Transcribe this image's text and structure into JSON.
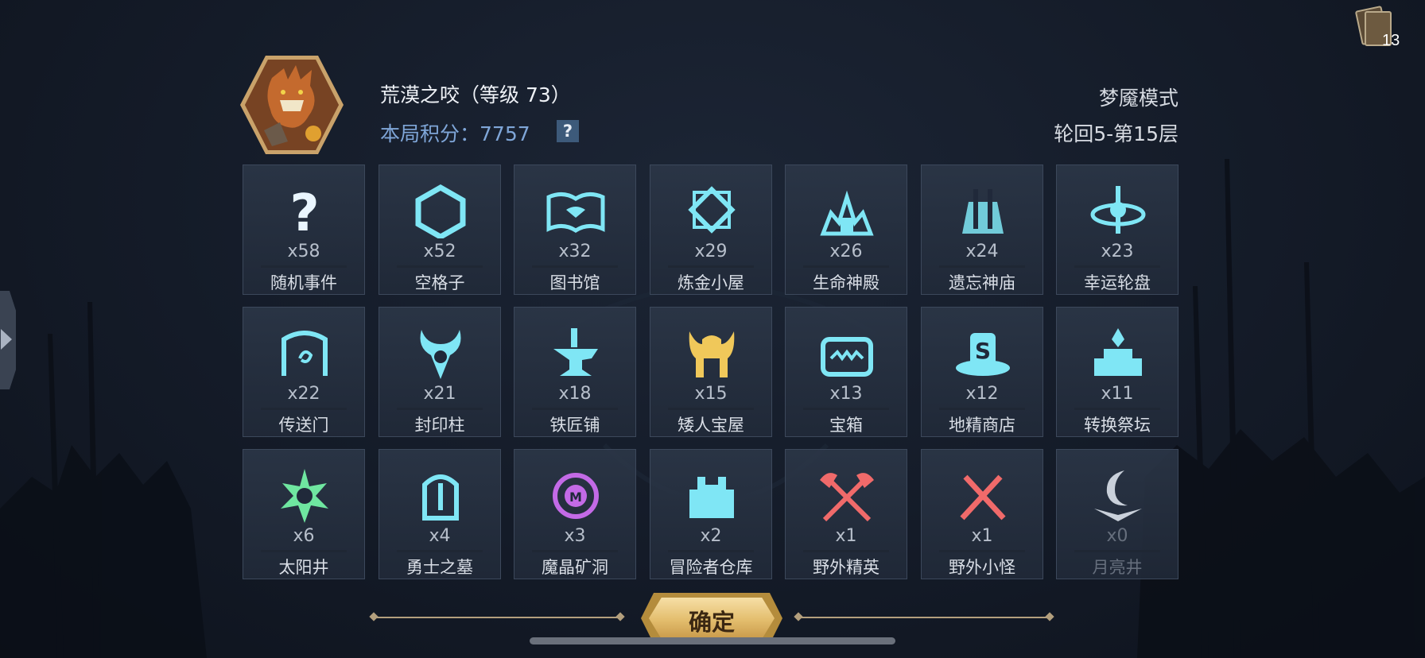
{
  "deck": {
    "icon": "card-deck-icon",
    "count": "13"
  },
  "side_tab": {
    "icon": "chevron-right-icon"
  },
  "player": {
    "avatar_icon": "werewolf-hero-portrait",
    "name_line": "荒漠之咬（等级 73）",
    "score_label": "本局积分：",
    "score_value": "7757",
    "help_label": "?"
  },
  "mode": {
    "name": "梦魇模式",
    "floor": "轮回5-第15层"
  },
  "colors": {
    "accent_cyan": "#7fe6f5",
    "gold": "#f0c85a",
    "red": "#f06a6a",
    "green": "#6fe6a0",
    "purple": "#c36ae6"
  },
  "tiles": [
    {
      "count": "x58",
      "name": "随机事件",
      "icon": "question-mark-icon",
      "color": "#eaf6ff"
    },
    {
      "count": "x52",
      "name": "空格子",
      "icon": "hexagon-icon",
      "color": "#7fe6f5"
    },
    {
      "count": "x32",
      "name": "图书馆",
      "icon": "open-book-icon",
      "color": "#7fe6f5"
    },
    {
      "count": "x29",
      "name": "炼金小屋",
      "icon": "alchemy-diamond-icon",
      "color": "#7fe6f5"
    },
    {
      "count": "x26",
      "name": "生命神殿",
      "icon": "temple-of-life-icon",
      "color": "#7fe6f5"
    },
    {
      "count": "x24",
      "name": "遗忘神庙",
      "icon": "forgotten-temple-icon",
      "color": "#7fe6f5"
    },
    {
      "count": "x23",
      "name": "幸运轮盘",
      "icon": "lucky-wheel-icon",
      "color": "#7fe6f5"
    },
    {
      "count": "x22",
      "name": "传送门",
      "icon": "portal-icon",
      "color": "#7fe6f5"
    },
    {
      "count": "x21",
      "name": "封印柱",
      "icon": "seal-pillar-icon",
      "color": "#7fe6f5"
    },
    {
      "count": "x18",
      "name": "铁匠铺",
      "icon": "anvil-icon",
      "color": "#7fe6f5"
    },
    {
      "count": "x15",
      "name": "矮人宝屋",
      "icon": "dwarf-helmet-icon",
      "color": "#f0c85a"
    },
    {
      "count": "x13",
      "name": "宝箱",
      "icon": "treasure-chest-icon",
      "color": "#7fe6f5"
    },
    {
      "count": "x12",
      "name": "地精商店",
      "icon": "goblin-shop-icon",
      "color": "#7fe6f5"
    },
    {
      "count": "x11",
      "name": "转换祭坛",
      "icon": "altar-icon",
      "color": "#7fe6f5"
    },
    {
      "count": "x6",
      "name": "太阳井",
      "icon": "sun-well-icon",
      "color": "#6fe6a0"
    },
    {
      "count": "x4",
      "name": "勇士之墓",
      "icon": "tombstone-icon",
      "color": "#7fe6f5"
    },
    {
      "count": "x3",
      "name": "魔晶矿洞",
      "icon": "magic-crystal-icon",
      "color": "#c36ae6"
    },
    {
      "count": "x2",
      "name": "冒险者仓库",
      "icon": "castle-warehouse-icon",
      "color": "#7fe6f5"
    },
    {
      "count": "x1",
      "name": "野外精英",
      "icon": "crossed-axes-icon",
      "color": "#f06a6a"
    },
    {
      "count": "x1",
      "name": "野外小怪",
      "icon": "crossed-swords-icon",
      "color": "#f06a6a"
    },
    {
      "count": "x0",
      "name": "月亮井",
      "icon": "moon-well-icon",
      "color": "#c9d0da",
      "dim": true
    }
  ],
  "confirm": {
    "label": "确定"
  }
}
